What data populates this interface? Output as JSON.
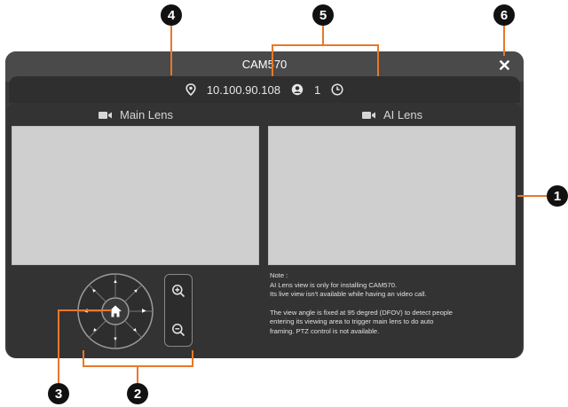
{
  "window": {
    "title": "CAM570",
    "close_label": "✕",
    "ip": "10.100.90.108",
    "user_count": "1"
  },
  "lenses": {
    "main_label": "Main Lens",
    "ai_label": "AI Lens"
  },
  "note": {
    "heading": "Note :",
    "line1": "AI Lens view is only for installing CAM570.",
    "line2": "Its live view isn't available while having an video call.",
    "line3": "The view angle is fixed at 95 degred (DFOV) to detect people",
    "line4": "entering its viewing area to trigger main lens to do auto",
    "line5": "framing. PTZ control is not available."
  },
  "callouts": {
    "c1": "1",
    "c2": "2",
    "c3": "3",
    "c4": "4",
    "c5": "5",
    "c6": "6"
  },
  "colors": {
    "callout_line": "#e8782a",
    "window_bg": "#3a3a3a",
    "view_bg": "#cfcfcf"
  }
}
